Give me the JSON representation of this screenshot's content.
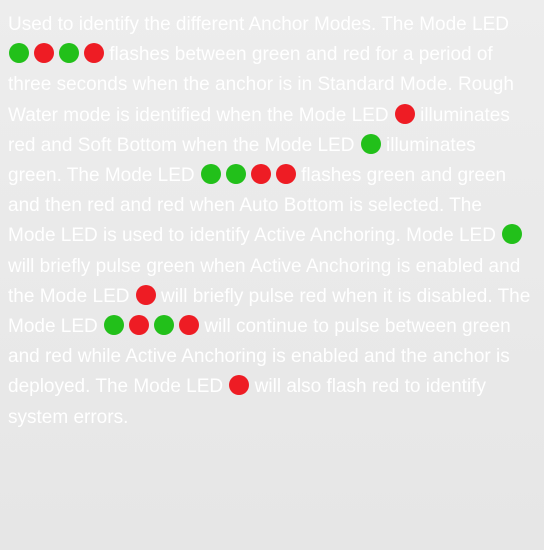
{
  "colors": {
    "background": "#e9e9e9",
    "text": "#ffffff",
    "led_green": "#22c01a",
    "led_red": "#ee1c24"
  },
  "paragraph": {
    "t1": "Used to identify the different Anchor Modes. The Mode LED ",
    "t2": " flashes between green and red for a period of three seconds when the anchor is in Standard Mode. Rough Water mode is identified when the Mode LED ",
    "t3": " illuminates red and Soft Bottom when the Mode LED ",
    "t4": " illuminates green. The Mode LED ",
    "t5": " flashes green and green and then red and red when Auto Bottom is selected. The Mode LED is used to identify Active Anchoring. Mode LED ",
    "t6": " will briefly pulse green when Active Anchoring is enabled and the Mode LED ",
    "t7": " will briefly pulse red when it is disabled. The Mode LED ",
    "t8": " will continue to pulse between green and red while Active Anchoring is enabled and the anchor is deployed. The Mode LED ",
    "t9": " will also flash red to identify system errors."
  },
  "led_sequences": {
    "standard_mode": [
      "green",
      "red",
      "green",
      "red"
    ],
    "rough_water": [
      "red"
    ],
    "soft_bottom": [
      "green"
    ],
    "auto_bottom": [
      "green",
      "green",
      "red",
      "red"
    ],
    "active_on": [
      "green"
    ],
    "active_off": [
      "red"
    ],
    "active_deployed": [
      "green",
      "red",
      "green",
      "red"
    ],
    "system_error": [
      "red"
    ]
  }
}
